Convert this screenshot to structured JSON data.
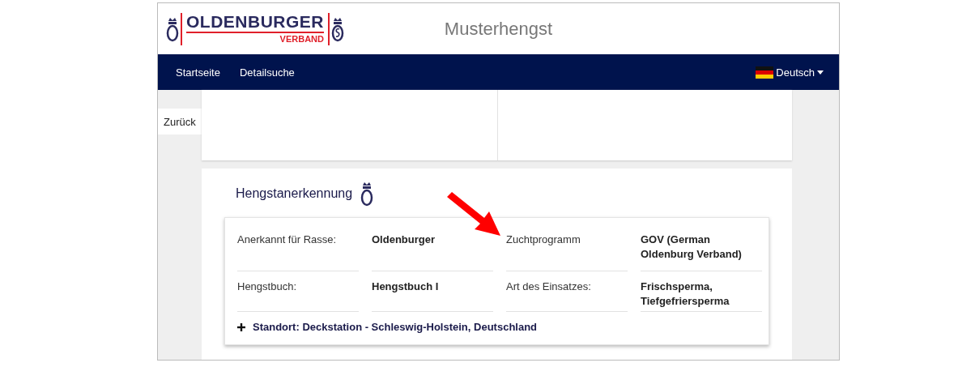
{
  "logo": {
    "name": "OLDENBURGER",
    "sub": "VERBAND"
  },
  "page_title": "Musterhengst",
  "nav": {
    "items": [
      {
        "label": "Startseite"
      },
      {
        "label": "Detailsuche"
      }
    ],
    "language": "Deutsch"
  },
  "back_tab": "Zurück",
  "section": {
    "title": "Hengstanerkennung",
    "fields": [
      {
        "label": "Anerkannt für Rasse:",
        "value": "Oldenburger"
      },
      {
        "label": "Zuchtprogramm",
        "value": "GOV (German Oldenburg Verband)"
      },
      {
        "label": "Hengstbuch:",
        "value": "Hengstbuch I"
      },
      {
        "label": "Art des Einsatzes:",
        "value": "Frischsperma, Tiefgefriersperma"
      }
    ],
    "location": {
      "text": "Standort: Deckstation - Schleswig-Holstein, Deutschland",
      "expanded": false
    }
  }
}
